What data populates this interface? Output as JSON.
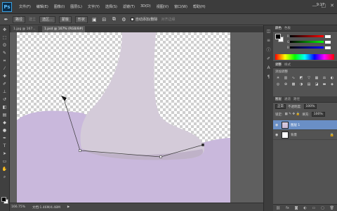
{
  "menubar": {
    "logo": "Ps",
    "items": [
      "文件(F)",
      "编辑(E)",
      "图像(I)",
      "图层(L)",
      "文字(Y)",
      "选择(S)",
      "滤镜(T)",
      "3D(D)",
      "视图(V)",
      "窗口(W)",
      "帮助(H)"
    ],
    "clock_time": "9:17",
    "clock_date": "2013/1/20",
    "window_buttons": [
      "—",
      "□",
      "✕"
    ]
  },
  "options": {
    "mode_label": "路径",
    "make_label": "建立",
    "selection_label": "选区...",
    "mask_label": "蒙版",
    "shape_label": "形状",
    "auto_add_delete": "自动添加/删除",
    "align_edges": "对齐边缘"
  },
  "document": {
    "tabs": [
      "1.jpg @ 167...",
      "1.psd @ 167% (RGB/8#)"
    ],
    "zoom": "166.75%",
    "doc_size": "文档:1.46M/4.48M",
    "canvas_colors": {
      "background_shape": "#c9b8dc",
      "sock": "#d4cbd9"
    }
  },
  "panels": {
    "color_tabs": [
      "颜色",
      "色板"
    ],
    "adjust_tabs": [
      "调整",
      "样式"
    ],
    "adjust_title": "添加调整",
    "layers_tabs": [
      "图层",
      "通道",
      "路径"
    ],
    "blend_mode": "正常",
    "opacity_label": "不透明度:",
    "opacity_value": "100%",
    "lock_label": "锁定:",
    "fill_label": "填充:",
    "fill_value": "100%",
    "layers": [
      {
        "name": "图层 1",
        "selected": true
      },
      {
        "name": "背景",
        "selected": false
      }
    ]
  }
}
